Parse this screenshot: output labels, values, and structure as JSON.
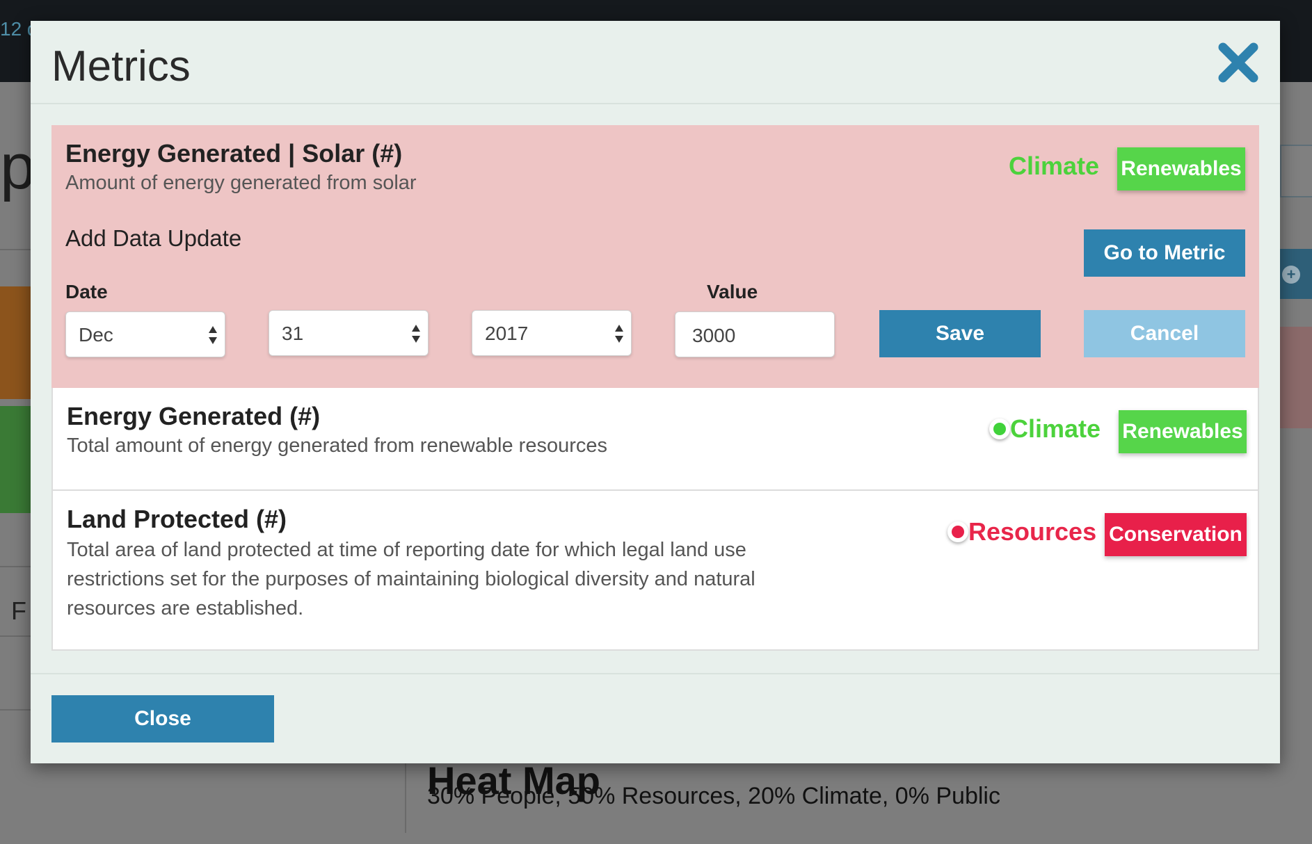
{
  "background": {
    "topbar_text": "12 d",
    "big_letter": "p",
    "f_letter": "F",
    "heatmap_title": "Heat Map",
    "heatmap_summary": "30% People, 50% Resources, 20% Climate, 0% Public"
  },
  "modal": {
    "title": "Metrics",
    "close_label": "Close"
  },
  "active_metric": {
    "title": "Energy Generated | Solar (#)",
    "description": "Amount of energy generated from solar",
    "category": "Climate",
    "tag": "Renewables",
    "add_data_title": "Add Data Update",
    "go_to_metric_label": "Go to Metric",
    "date_label": "Date",
    "value_label": "Value",
    "month": "Dec",
    "day": "31",
    "year": "2017",
    "value": "3000",
    "save_label": "Save",
    "cancel_label": "Cancel"
  },
  "metrics": [
    {
      "title": "Energy Generated (#)",
      "description": "Total amount of energy generated from renewable resources",
      "category": "Climate",
      "tag": "Renewables",
      "status": "green"
    },
    {
      "title": "Land Protected (#)",
      "description_lines": [
        "Total area of land protected at time of reporting date for which legal land use",
        "restrictions set for the purposes of maintaining biological diversity and natural",
        "resources are established."
      ],
      "category": "Resources",
      "tag": "Conservation",
      "status": "red"
    }
  ],
  "colors": {
    "climate_green": "#4cd23c",
    "resources_red": "#e8264a",
    "primary_blue": "#2e82ae",
    "active_row_bg": "#eec5c5"
  }
}
